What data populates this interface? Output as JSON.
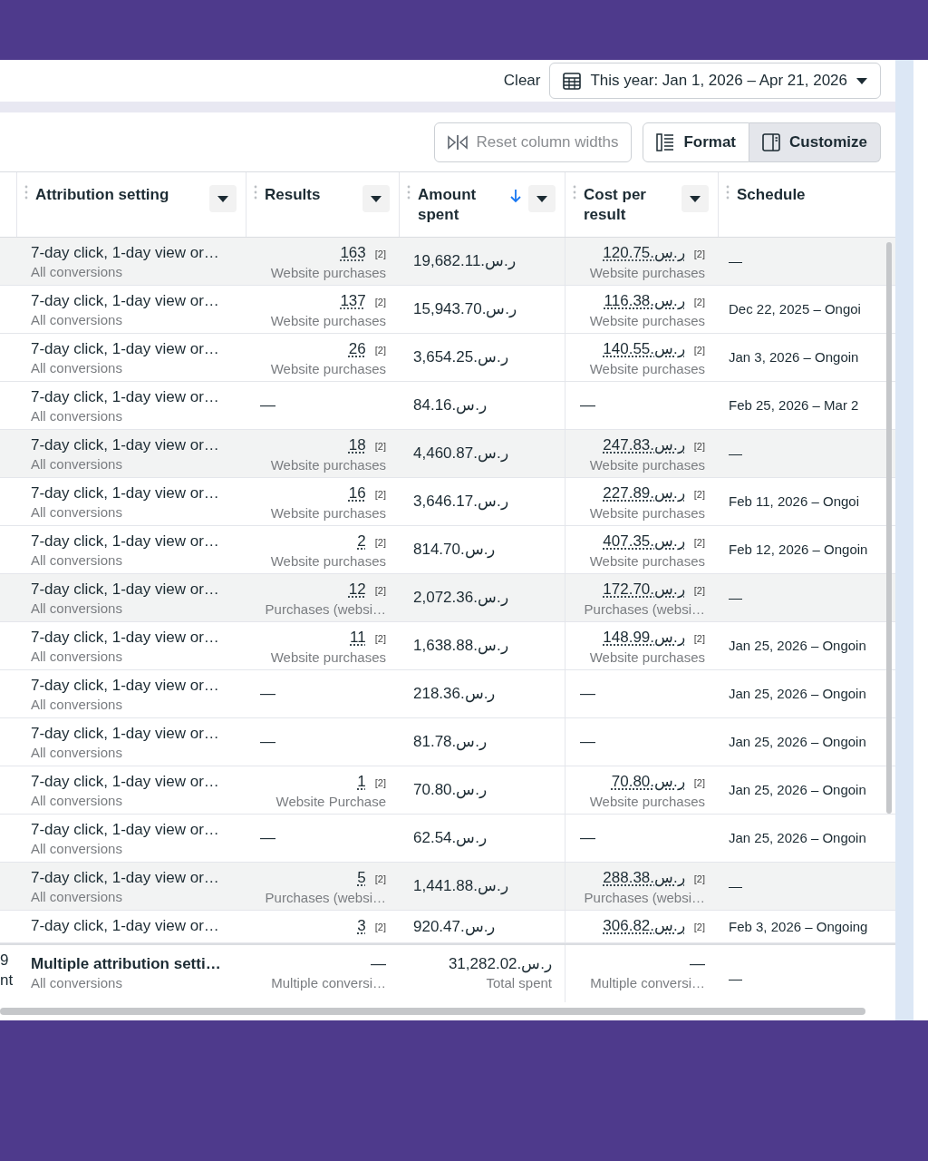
{
  "header": {
    "clear_link": "Clear",
    "date_range": "This year: Jan 1, 2026 – Apr 21, 2026"
  },
  "toolbar": {
    "buttons": [
      {
        "kind": "reset",
        "label": "Reset column widths",
        "disabled": true,
        "selected": false
      },
      {
        "kind": "format",
        "label": "Format",
        "disabled": false,
        "selected": false
      },
      {
        "kind": "customize",
        "label": "Customize",
        "disabled": false,
        "selected": true
      }
    ]
  },
  "columns": [
    {
      "label": "Attribution setting",
      "sorted": false
    },
    {
      "label": "Results",
      "sorted": false
    },
    {
      "label": "Amount spent",
      "sorted": true
    },
    {
      "label": "Cost per result",
      "sorted": false
    },
    {
      "label": "Schedule",
      "sorted": false
    }
  ],
  "rows": [
    {
      "shaded": true,
      "attribution": "7-day click, 1-day view or…",
      "attribution_note": "All conversions",
      "results": "163",
      "results_note": "[2]",
      "results_type": "Website purchases",
      "amount_spent": "19,682.11.ر.س",
      "cost_per_result": "120.75.ر.س",
      "cost_note": "[2]",
      "cost_type": "Website purchases",
      "schedule": "—"
    },
    {
      "shaded": false,
      "attribution": "7-day click, 1-day view or…",
      "attribution_note": "All conversions",
      "results": "137",
      "results_note": "[2]",
      "results_type": "Website purchases",
      "amount_spent": "15,943.70.ر.س",
      "cost_per_result": "116.38.ر.س",
      "cost_note": "[2]",
      "cost_type": "Website purchases",
      "schedule": "Dec 22, 2025 – Ongoi"
    },
    {
      "shaded": false,
      "attribution": "7-day click, 1-day view or…",
      "attribution_note": "All conversions",
      "results": "26",
      "results_note": "[2]",
      "results_type": "Website purchases",
      "amount_spent": "3,654.25.ر.س",
      "cost_per_result": "140.55.ر.س",
      "cost_note": "[2]",
      "cost_type": "Website purchases",
      "schedule": "Jan 3, 2026 – Ongoin"
    },
    {
      "shaded": false,
      "attribution": "7-day click, 1-day view or…",
      "attribution_note": "All conversions",
      "results": "—",
      "amount_spent": "84.16.ر.س",
      "cost_per_result": "—",
      "schedule": "Feb 25, 2026 – Mar 2"
    },
    {
      "shaded": true,
      "attribution": "7-day click, 1-day view or…",
      "attribution_note": "All conversions",
      "results": "18",
      "results_note": "[2]",
      "results_type": "Website purchases",
      "amount_spent": "4,460.87.ر.س",
      "cost_per_result": "247.83.ر.س",
      "cost_note": "[2]",
      "cost_type": "Website purchases",
      "schedule": "—"
    },
    {
      "shaded": false,
      "attribution": "7-day click, 1-day view or…",
      "attribution_note": "All conversions",
      "results": "16",
      "results_note": "[2]",
      "results_type": "Website purchases",
      "amount_spent": "3,646.17.ر.س",
      "cost_per_result": "227.89.ر.س",
      "cost_note": "[2]",
      "cost_type": "Website purchases",
      "schedule": "Feb 11, 2026 – Ongoi"
    },
    {
      "shaded": false,
      "attribution": "7-day click, 1-day view or…",
      "attribution_note": "All conversions",
      "results": "2",
      "results_note": "[2]",
      "results_type": "Website purchases",
      "amount_spent": "814.70.ر.س",
      "cost_per_result": "407.35.ر.س",
      "cost_note": "[2]",
      "cost_type": "Website purchases",
      "schedule": "Feb 12, 2026 – Ongoin"
    },
    {
      "shaded": true,
      "attribution": "7-day click, 1-day view or…",
      "attribution_note": "All conversions",
      "results": "12",
      "results_note": "[2]",
      "results_type": "Purchases (websi…",
      "amount_spent": "2,072.36.ر.س",
      "cost_per_result": "172.70.ر.س",
      "cost_note": "[2]",
      "cost_type": "Purchases (websi…",
      "schedule": "—"
    },
    {
      "shaded": false,
      "attribution": "7-day click, 1-day view or…",
      "attribution_note": "All conversions",
      "results": "11",
      "results_note": "[2]",
      "results_type": "Website purchases",
      "amount_spent": "1,638.88.ر.س",
      "cost_per_result": "148.99.ر.س",
      "cost_note": "[2]",
      "cost_type": "Website purchases",
      "schedule": "Jan 25, 2026 – Ongoin"
    },
    {
      "shaded": false,
      "attribution": "7-day click, 1-day view or…",
      "attribution_note": "All conversions",
      "results": "—",
      "amount_spent": "218.36.ر.س",
      "cost_per_result": "—",
      "schedule": "Jan 25, 2026 – Ongoin"
    },
    {
      "shaded": false,
      "attribution": "7-day click, 1-day view or…",
      "attribution_note": "All conversions",
      "results": "—",
      "amount_spent": "81.78.ر.س",
      "cost_per_result": "—",
      "schedule": "Jan 25, 2026 – Ongoin"
    },
    {
      "shaded": false,
      "attribution": "7-day click, 1-day view or…",
      "attribution_note": "All conversions",
      "results": "1",
      "results_note": "[2]",
      "results_type": "Website Purchase",
      "amount_spent": "70.80.ر.س",
      "cost_per_result": "70.80.ر.س",
      "cost_note": "[2]",
      "cost_type": "Website purchases",
      "schedule": "Jan 25, 2026 – Ongoin"
    },
    {
      "shaded": false,
      "attribution": "7-day click, 1-day view or…",
      "attribution_note": "All conversions",
      "results": "—",
      "amount_spent": "62.54.ر.س",
      "cost_per_result": "—",
      "schedule": "Jan 25, 2026 – Ongoin"
    },
    {
      "shaded": true,
      "attribution": "7-day click, 1-day view or…",
      "attribution_note": "All conversions",
      "results": "5",
      "results_note": "[2]",
      "results_type": "Purchases (websi…",
      "amount_spent": "1,441.88.ر.س",
      "cost_per_result": "288.38.ر.س",
      "cost_note": "[2]",
      "cost_type": "Purchases (websi…",
      "schedule": "—"
    },
    {
      "shaded": false,
      "attribution": "7-day click, 1-day view or…",
      "results": "3",
      "results_note": "[2]",
      "amount_spent": "920.47.ر.س",
      "cost_per_result": "306.82.ر.س",
      "cost_note": "[2]",
      "schedule": "Feb 3, 2026 – Ongoing"
    }
  ],
  "footer": {
    "column_1": [
      "9",
      "nt"
    ],
    "attribution": "Multiple attribution setti…",
    "attribution_note": "All conversions",
    "results": "—",
    "results_type": "Multiple conversi…",
    "amount_spent": "31,282.02.ر.س",
    "amount_note": "Total spent",
    "cost_per_result": "—",
    "cost_type": "Multiple conversi…",
    "schedule": "—"
  }
}
